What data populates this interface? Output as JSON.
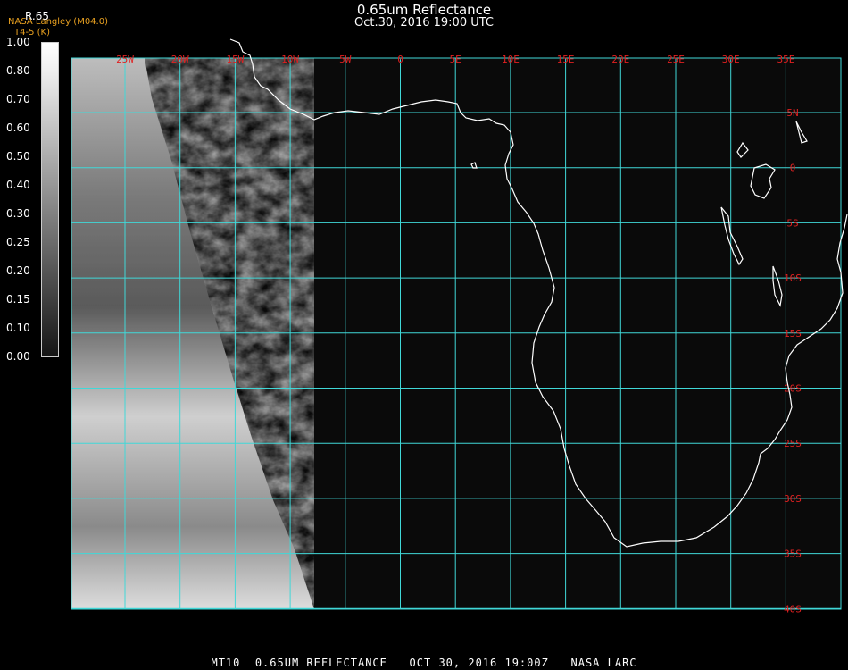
{
  "header": {
    "title": "0.65um Reflectance",
    "subtitle": "Oct.30, 2016 19:00 UTC"
  },
  "credit": {
    "line1": "NASA Langley (M04.0)",
    "line2": "T4-5 (K)"
  },
  "colorbar": {
    "label": "R.65",
    "ticks": [
      "1.00",
      "0.80",
      "0.70",
      "0.60",
      "0.50",
      "0.40",
      "0.30",
      "0.25",
      "0.20",
      "0.15",
      "0.10",
      "0.00"
    ],
    "colors": [
      "#ffffff",
      "#f0f0f0",
      "#dcdcdc",
      "#c8c8c8",
      "#b4b4b4",
      "#a0a0a0",
      "#8c8c8c",
      "#787878",
      "#646464",
      "#505050",
      "#3c3c3c",
      "#282828",
      "#141414"
    ]
  },
  "map": {
    "longitude_labels": [
      "25W",
      "20W",
      "15W",
      "10W",
      "5W",
      "0",
      "5E",
      "10E",
      "15E",
      "20E",
      "25E",
      "30E",
      "35E"
    ],
    "latitude_labels": [
      "5N",
      "0",
      "5S",
      "10S",
      "15S",
      "20S",
      "25S",
      "30S",
      "35S",
      "40S"
    ],
    "grid_color": "#40d8d8",
    "label_color": "#e02020",
    "coastline_color": "#ffffff"
  },
  "footer": {
    "text": "MT10  0.65UM REFLECTANCE   OCT 30, 2016 19:00Z   NASA LARC"
  }
}
